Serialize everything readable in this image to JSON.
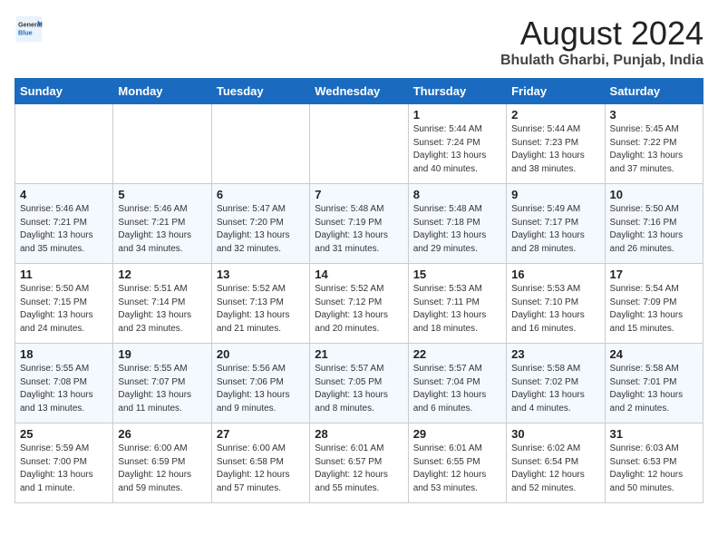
{
  "logo": {
    "general": "General",
    "blue": "Blue"
  },
  "title": "August 2024",
  "location": "Bhulath Gharbi, Punjab, India",
  "days_of_week": [
    "Sunday",
    "Monday",
    "Tuesday",
    "Wednesday",
    "Thursday",
    "Friday",
    "Saturday"
  ],
  "weeks": [
    [
      {
        "day": "",
        "info": ""
      },
      {
        "day": "",
        "info": ""
      },
      {
        "day": "",
        "info": ""
      },
      {
        "day": "",
        "info": ""
      },
      {
        "day": "1",
        "info": "Sunrise: 5:44 AM\nSunset: 7:24 PM\nDaylight: 13 hours\nand 40 minutes."
      },
      {
        "day": "2",
        "info": "Sunrise: 5:44 AM\nSunset: 7:23 PM\nDaylight: 13 hours\nand 38 minutes."
      },
      {
        "day": "3",
        "info": "Sunrise: 5:45 AM\nSunset: 7:22 PM\nDaylight: 13 hours\nand 37 minutes."
      }
    ],
    [
      {
        "day": "4",
        "info": "Sunrise: 5:46 AM\nSunset: 7:21 PM\nDaylight: 13 hours\nand 35 minutes."
      },
      {
        "day": "5",
        "info": "Sunrise: 5:46 AM\nSunset: 7:21 PM\nDaylight: 13 hours\nand 34 minutes."
      },
      {
        "day": "6",
        "info": "Sunrise: 5:47 AM\nSunset: 7:20 PM\nDaylight: 13 hours\nand 32 minutes."
      },
      {
        "day": "7",
        "info": "Sunrise: 5:48 AM\nSunset: 7:19 PM\nDaylight: 13 hours\nand 31 minutes."
      },
      {
        "day": "8",
        "info": "Sunrise: 5:48 AM\nSunset: 7:18 PM\nDaylight: 13 hours\nand 29 minutes."
      },
      {
        "day": "9",
        "info": "Sunrise: 5:49 AM\nSunset: 7:17 PM\nDaylight: 13 hours\nand 28 minutes."
      },
      {
        "day": "10",
        "info": "Sunrise: 5:50 AM\nSunset: 7:16 PM\nDaylight: 13 hours\nand 26 minutes."
      }
    ],
    [
      {
        "day": "11",
        "info": "Sunrise: 5:50 AM\nSunset: 7:15 PM\nDaylight: 13 hours\nand 24 minutes."
      },
      {
        "day": "12",
        "info": "Sunrise: 5:51 AM\nSunset: 7:14 PM\nDaylight: 13 hours\nand 23 minutes."
      },
      {
        "day": "13",
        "info": "Sunrise: 5:52 AM\nSunset: 7:13 PM\nDaylight: 13 hours\nand 21 minutes."
      },
      {
        "day": "14",
        "info": "Sunrise: 5:52 AM\nSunset: 7:12 PM\nDaylight: 13 hours\nand 20 minutes."
      },
      {
        "day": "15",
        "info": "Sunrise: 5:53 AM\nSunset: 7:11 PM\nDaylight: 13 hours\nand 18 minutes."
      },
      {
        "day": "16",
        "info": "Sunrise: 5:53 AM\nSunset: 7:10 PM\nDaylight: 13 hours\nand 16 minutes."
      },
      {
        "day": "17",
        "info": "Sunrise: 5:54 AM\nSunset: 7:09 PM\nDaylight: 13 hours\nand 15 minutes."
      }
    ],
    [
      {
        "day": "18",
        "info": "Sunrise: 5:55 AM\nSunset: 7:08 PM\nDaylight: 13 hours\nand 13 minutes."
      },
      {
        "day": "19",
        "info": "Sunrise: 5:55 AM\nSunset: 7:07 PM\nDaylight: 13 hours\nand 11 minutes."
      },
      {
        "day": "20",
        "info": "Sunrise: 5:56 AM\nSunset: 7:06 PM\nDaylight: 13 hours\nand 9 minutes."
      },
      {
        "day": "21",
        "info": "Sunrise: 5:57 AM\nSunset: 7:05 PM\nDaylight: 13 hours\nand 8 minutes."
      },
      {
        "day": "22",
        "info": "Sunrise: 5:57 AM\nSunset: 7:04 PM\nDaylight: 13 hours\nand 6 minutes."
      },
      {
        "day": "23",
        "info": "Sunrise: 5:58 AM\nSunset: 7:02 PM\nDaylight: 13 hours\nand 4 minutes."
      },
      {
        "day": "24",
        "info": "Sunrise: 5:58 AM\nSunset: 7:01 PM\nDaylight: 13 hours\nand 2 minutes."
      }
    ],
    [
      {
        "day": "25",
        "info": "Sunrise: 5:59 AM\nSunset: 7:00 PM\nDaylight: 13 hours\nand 1 minute."
      },
      {
        "day": "26",
        "info": "Sunrise: 6:00 AM\nSunset: 6:59 PM\nDaylight: 12 hours\nand 59 minutes."
      },
      {
        "day": "27",
        "info": "Sunrise: 6:00 AM\nSunset: 6:58 PM\nDaylight: 12 hours\nand 57 minutes."
      },
      {
        "day": "28",
        "info": "Sunrise: 6:01 AM\nSunset: 6:57 PM\nDaylight: 12 hours\nand 55 minutes."
      },
      {
        "day": "29",
        "info": "Sunrise: 6:01 AM\nSunset: 6:55 PM\nDaylight: 12 hours\nand 53 minutes."
      },
      {
        "day": "30",
        "info": "Sunrise: 6:02 AM\nSunset: 6:54 PM\nDaylight: 12 hours\nand 52 minutes."
      },
      {
        "day": "31",
        "info": "Sunrise: 6:03 AM\nSunset: 6:53 PM\nDaylight: 12 hours\nand 50 minutes."
      }
    ]
  ]
}
